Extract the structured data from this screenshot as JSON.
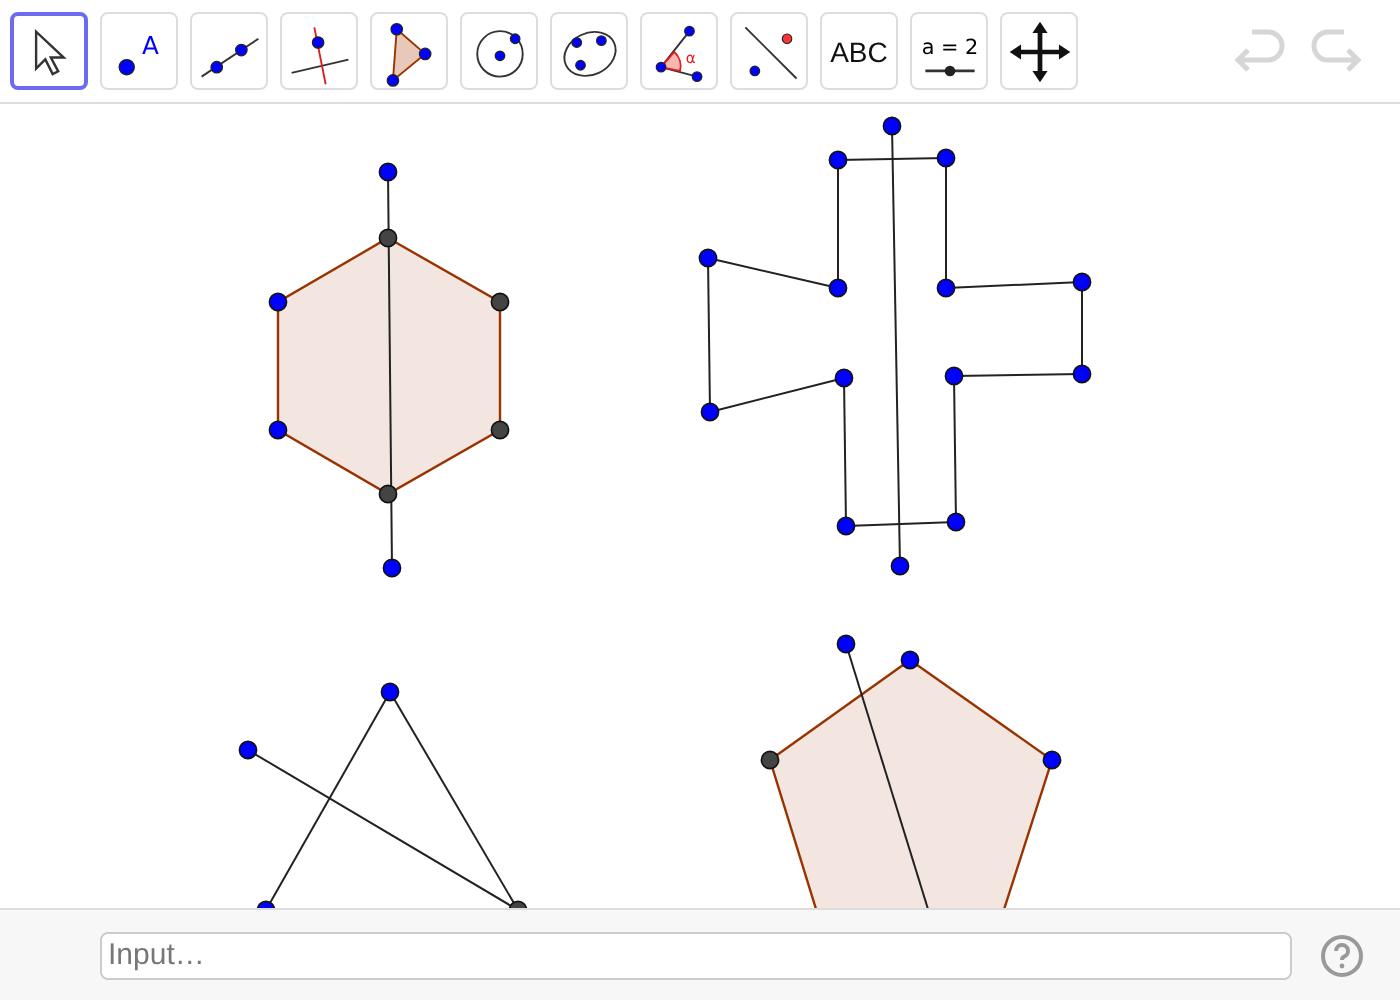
{
  "toolbar": {
    "tools": [
      {
        "kind": "move",
        "selected": true
      },
      {
        "kind": "point",
        "selected": false,
        "glyph": "A"
      },
      {
        "kind": "line",
        "selected": false
      },
      {
        "kind": "perpendicular",
        "selected": false
      },
      {
        "kind": "polygon",
        "selected": false
      },
      {
        "kind": "circle",
        "selected": false
      },
      {
        "kind": "conic",
        "selected": false
      },
      {
        "kind": "angle",
        "selected": false,
        "glyph": "α"
      },
      {
        "kind": "reflect",
        "selected": false
      },
      {
        "kind": "text",
        "selected": false,
        "label": "ABC"
      },
      {
        "kind": "slider",
        "selected": false,
        "label": "a = 2"
      },
      {
        "kind": "pan",
        "selected": false
      }
    ],
    "undo": {
      "disabled": true
    },
    "redo": {
      "disabled": true
    }
  },
  "input_bar": {
    "placeholder": "Input…"
  }
}
